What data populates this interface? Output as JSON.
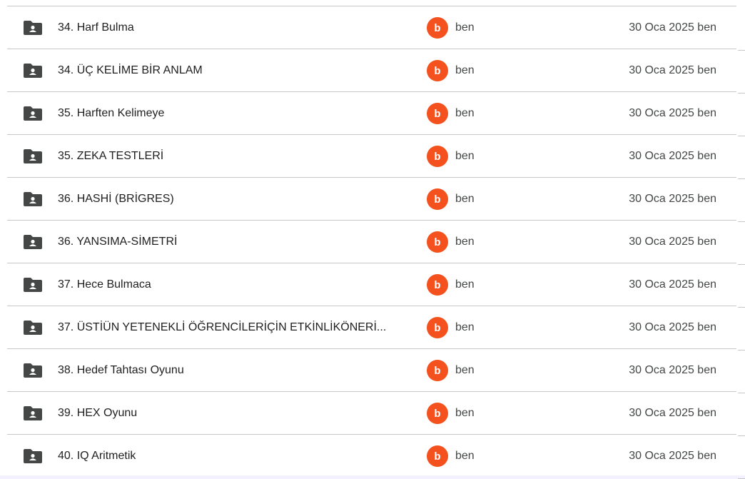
{
  "rows": [
    {
      "name": "34. Harf Bulma",
      "owner_initial": "b",
      "owner": "ben",
      "modified": "30 Oca 2025 ben"
    },
    {
      "name": "34. ÜÇ KELİME BİR ANLAM",
      "owner_initial": "b",
      "owner": "ben",
      "modified": "30 Oca 2025 ben"
    },
    {
      "name": "35. Harften Kelimeye",
      "owner_initial": "b",
      "owner": "ben",
      "modified": "30 Oca 2025 ben"
    },
    {
      "name": "35. ZEKA TESTLERİ",
      "owner_initial": "b",
      "owner": "ben",
      "modified": "30 Oca 2025 ben"
    },
    {
      "name": "36. HASHİ (BRİGRES)",
      "owner_initial": "b",
      "owner": "ben",
      "modified": "30 Oca 2025 ben"
    },
    {
      "name": "36. YANSIMA-SİMETRİ",
      "owner_initial": "b",
      "owner": "ben",
      "modified": "30 Oca 2025 ben"
    },
    {
      "name": "37. Hece Bulmaca",
      "owner_initial": "b",
      "owner": "ben",
      "modified": "30 Oca 2025 ben"
    },
    {
      "name": "37. ÜSTİÜN YETENEKLİ ÖĞRENCİLERİÇİN ETKİNLİKÖNERİ...",
      "owner_initial": "b",
      "owner": "ben",
      "modified": "30 Oca 2025 ben"
    },
    {
      "name": "38. Hedef Tahtası Oyunu",
      "owner_initial": "b",
      "owner": "ben",
      "modified": "30 Oca 2025 ben"
    },
    {
      "name": "39. HEX Oyunu",
      "owner_initial": "b",
      "owner": "ben",
      "modified": "30 Oca 2025 ben"
    },
    {
      "name": "40. IQ Aritmetik",
      "owner_initial": "b",
      "owner": "ben",
      "modified": "30 Oca 2025 ben"
    }
  ],
  "colors": {
    "avatar": "#f4511e",
    "folder_icon": "#444746",
    "divider": "#c7c7c7"
  },
  "icons": {
    "row_icon": "shared-folder-icon"
  }
}
